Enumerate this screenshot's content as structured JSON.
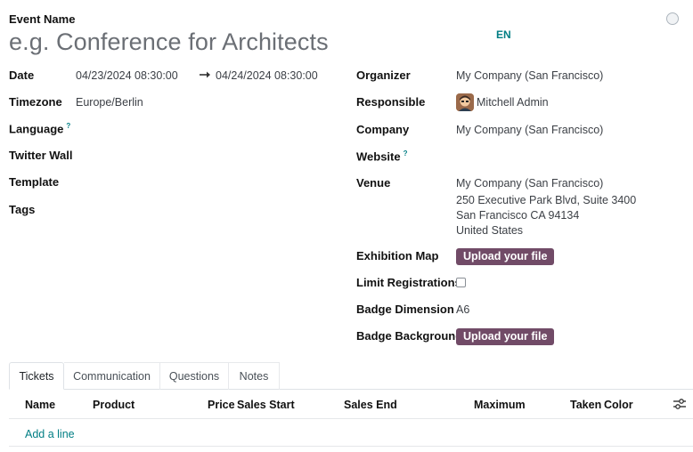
{
  "header": {
    "event_name_label": "Event Name",
    "event_name_placeholder": "e.g. Conference for Architects",
    "lang_code": "EN"
  },
  "left_fields": {
    "date_label": "Date",
    "date_start": "04/23/2024 08:30:00",
    "date_end": "04/24/2024 08:30:00",
    "timezone_label": "Timezone",
    "timezone_value": "Europe/Berlin",
    "language_label": "Language",
    "language_help": "?",
    "twitter_wall_label": "Twitter Wall",
    "template_label": "Template",
    "tags_label": "Tags"
  },
  "right_fields": {
    "organizer_label": "Organizer",
    "organizer_value": "My Company (San Francisco)",
    "responsible_label": "Responsible",
    "responsible_value": "Mitchell Admin",
    "company_label": "Company",
    "company_value": "My Company (San Francisco)",
    "website_label": "Website",
    "website_help": "?",
    "venue_label": "Venue",
    "venue_name": "My Company (San Francisco)",
    "venue_line1": "250 Executive Park Blvd, Suite 3400",
    "venue_line2": "San Francisco CA 94134",
    "venue_line3": "United States",
    "exhibition_map_label": "Exhibition Map",
    "exhibition_map_button": "Upload your file",
    "limit_registrations_label": "Limit Registrations",
    "limit_registrations_checked": false,
    "badge_dimension_label": "Badge Dimension",
    "badge_dimension_value": "A6",
    "badge_background_label": "Badge Background",
    "badge_background_button": "Upload your file"
  },
  "tabs": [
    {
      "label": "Tickets",
      "active": true
    },
    {
      "label": "Communication",
      "active": false
    },
    {
      "label": "Questions",
      "active": false
    },
    {
      "label": "Notes",
      "active": false
    }
  ],
  "tickets_table": {
    "columns": [
      "Name",
      "Product",
      "Price",
      "Sales Start",
      "Sales End",
      "Maximum",
      "Taken",
      "Color"
    ],
    "add_line": "Add a line"
  },
  "colors": {
    "primary": "#714b67",
    "link": "#017e84",
    "text": "#212529"
  },
  "icons": {
    "status": "status-circle-icon",
    "arrow": "arrow-right-icon",
    "settings": "optional-columns-icon"
  }
}
